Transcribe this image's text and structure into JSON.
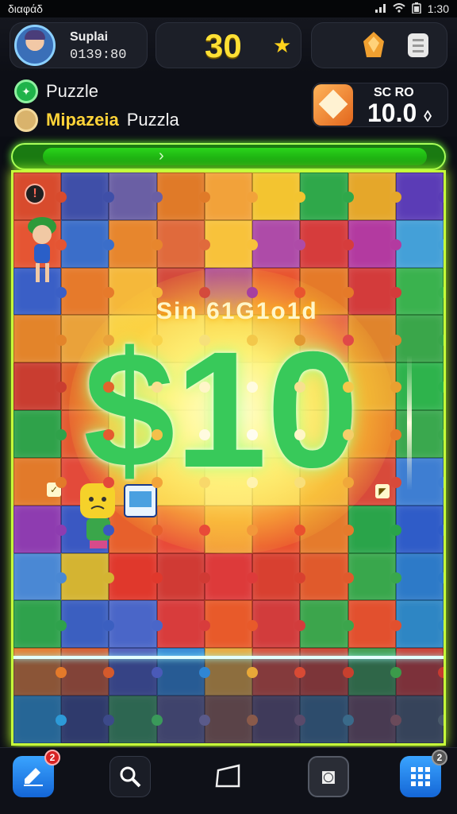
{
  "status_bar": {
    "left_text": "διαφάδ",
    "time": "1:30"
  },
  "profile": {
    "name": "Suplai",
    "code": "0139:80"
  },
  "top_score": {
    "value": "30",
    "star": "★"
  },
  "mode": {
    "label": "Puzzle",
    "title": "Mipazeia",
    "subtitle": "Puzzla"
  },
  "score_box": {
    "label": "SC RO",
    "value": "10.0",
    "suffix": "◊"
  },
  "progress": {
    "fraction": 0.33
  },
  "banner": {
    "title": "Sin 61G1o1d",
    "number": "$10"
  },
  "board": {
    "alert_symbol": "!",
    "tile_colors": [
      "#d84b2d",
      "#3f4fa8",
      "#6a5fa4",
      "#e07a28",
      "#f2a23a",
      "#f3c430",
      "#2fa84a",
      "#e5a72a",
      "#5b3cb6",
      "#e55533",
      "#3b6ec9",
      "#e7862d",
      "#e06a3c",
      "#f8c23b",
      "#ae4ba8",
      "#d63c3c",
      "#b33aa0",
      "#44a0d8",
      "#3a5fc6",
      "#e67a2b",
      "#f5b83a",
      "#d44a3c",
      "#a63fa0",
      "#e8542f",
      "#e57a29",
      "#d33b3b",
      "#3ab24e",
      "#e3842a",
      "#eaa23a",
      "#f8d34a",
      "#f6e07a",
      "#f3c84a",
      "#e29830",
      "#e04848",
      "#e0842c",
      "#3aa64a",
      "#c93d30",
      "#e2642c",
      "#f8e090",
      "#fff6c8",
      "#fffbe0",
      "#f7e090",
      "#f5c84a",
      "#e8a030",
      "#2eb34c",
      "#2fa24a",
      "#e45a30",
      "#f4c04a",
      "#fffbe0",
      "#fffdf0",
      "#fff6c8",
      "#f5cf6a",
      "#e87b2a",
      "#3aa84e",
      "#e27a2a",
      "#e34a3a",
      "#f2a43a",
      "#f8d86a",
      "#fff3b0",
      "#f8df7a",
      "#f0a83a",
      "#d84a3a",
      "#3e7ed2",
      "#8e3cb0",
      "#3a58c2",
      "#e7602c",
      "#e84a38",
      "#f2983a",
      "#e9502e",
      "#e57b2c",
      "#2aa44a",
      "#2f5cc8",
      "#4a88d4",
      "#d4b432",
      "#e0382c",
      "#d03a34",
      "#dd3a3a",
      "#d84030",
      "#e05a2c",
      "#39a74c",
      "#2d7ac8",
      "#2fa24c",
      "#3b5fc0",
      "#4a66c8",
      "#d83c3c",
      "#e85a2a",
      "#d23c3c",
      "#3ca54c",
      "#e2502e",
      "#2e86c4",
      "#e47a2a",
      "#d45a2c",
      "#4a5ab8",
      "#2f86d4",
      "#e8a838",
      "#d84a34",
      "#c8402e",
      "#3c9a4a",
      "#c83a30",
      "#2d9ad8",
      "#3c4a8a",
      "#3a9a5a",
      "#5a5a8a",
      "#8a5a4a",
      "#5a4a6a",
      "#3a6a8a",
      "#6a4a5a",
      "#4a5a6a"
    ]
  },
  "nav": {
    "edit_badge": "2",
    "camera_symbol": "◙",
    "grid_badge": "2"
  }
}
